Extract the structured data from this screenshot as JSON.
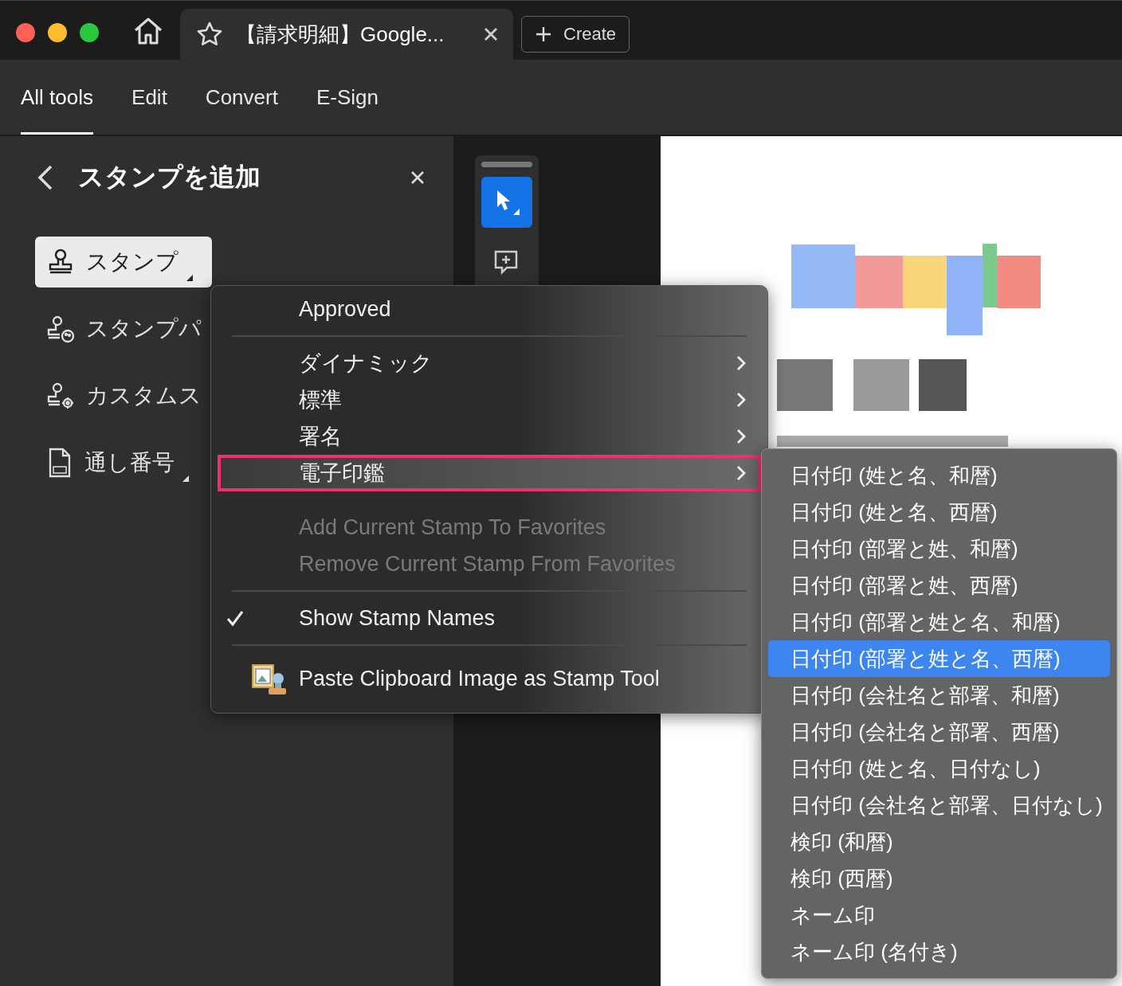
{
  "window": {
    "tabs": [
      {
        "title": "【請求明細】Google...",
        "selected": true
      }
    ],
    "create_button": "Create"
  },
  "nav_tabs": [
    {
      "label": "All tools",
      "selected": true
    },
    {
      "label": "Edit",
      "selected": false
    },
    {
      "label": "Convert",
      "selected": false
    },
    {
      "label": "E-Sign",
      "selected": false
    }
  ],
  "panel": {
    "title": "スタンプを追加",
    "items": [
      {
        "label": "スタンプ",
        "kind": "stamp",
        "selected": true,
        "dropdown": true
      },
      {
        "label": "スタンプパ",
        "kind": "palette",
        "selected": false,
        "dropdown": false
      },
      {
        "label": "カスタムス",
        "kind": "custom",
        "selected": false,
        "dropdown": false
      },
      {
        "label": "通し番号",
        "kind": "number",
        "selected": false,
        "dropdown": true
      }
    ]
  },
  "toolbar": [
    {
      "kind": "select",
      "selected": true
    },
    {
      "kind": "comment",
      "selected": false
    }
  ],
  "menu": {
    "items": [
      {
        "kind": "item",
        "label": "Approved"
      },
      {
        "kind": "separator"
      },
      {
        "kind": "submenu",
        "label": "ダイナミック",
        "highlighted": false
      },
      {
        "kind": "submenu",
        "label": "標準",
        "highlighted": false
      },
      {
        "kind": "submenu",
        "label": "署名",
        "highlighted": false
      },
      {
        "kind": "submenu",
        "label": "電子印鑑",
        "highlighted": true
      },
      {
        "kind": "gap"
      },
      {
        "kind": "disabled",
        "label": "Add Current Stamp To Favorites"
      },
      {
        "kind": "disabled",
        "label": "Remove Current Stamp From Favorites"
      },
      {
        "kind": "separator"
      },
      {
        "kind": "check",
        "label": "Show Stamp Names",
        "checked": true
      },
      {
        "kind": "separator"
      },
      {
        "kind": "paste",
        "label": "Paste Clipboard Image as Stamp Tool"
      }
    ]
  },
  "submenu": {
    "items": [
      {
        "label": "日付印 (姓と名、和暦)",
        "selected": false
      },
      {
        "label": "日付印 (姓と名、西暦)",
        "selected": false
      },
      {
        "label": "日付印 (部署と姓、和暦)",
        "selected": false
      },
      {
        "label": "日付印 (部署と姓、西暦)",
        "selected": false
      },
      {
        "label": "日付印 (部署と姓と名、和暦)",
        "selected": false
      },
      {
        "label": "日付印 (部署と姓と名、西暦)",
        "selected": true
      },
      {
        "label": "日付印 (会社名と部署、和暦)",
        "selected": false
      },
      {
        "label": "日付印 (会社名と部署、西暦)",
        "selected": false
      },
      {
        "label": "日付印 (姓と名、日付なし)",
        "selected": false
      },
      {
        "label": "日付印 (会社名と部署、日付なし)",
        "selected": false
      },
      {
        "label": "検印 (和暦)",
        "selected": false
      },
      {
        "label": "検印 (西暦)",
        "selected": false
      },
      {
        "label": "ネーム印",
        "selected": false
      },
      {
        "label": "ネーム印 (名付き)",
        "selected": false
      }
    ]
  }
}
